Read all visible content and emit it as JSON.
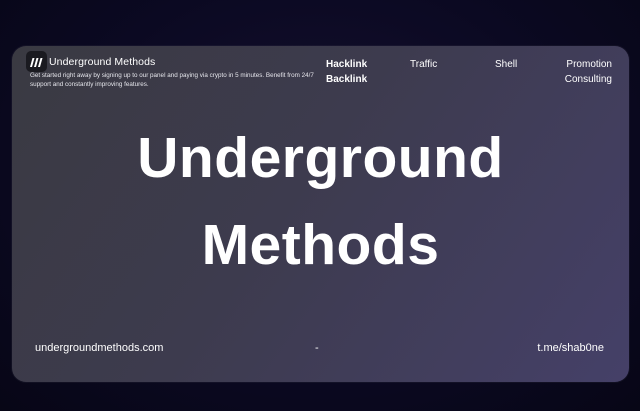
{
  "header": {
    "brand": "Underground Methods",
    "tagline": "Get started right away by signing up to our panel and paying via crypto in 5 minutes. Benefit from 24/7 support and constantly improving features."
  },
  "nav": {
    "hacklink": "Hacklink",
    "backlink": "Backlink",
    "traffic": "Traffic",
    "shell": "Shell",
    "promotion": "Promotion",
    "consulting": "Consulting"
  },
  "hero": {
    "line1": "Underground",
    "line2": "Methods"
  },
  "footer": {
    "website": "undergroundmethods.com",
    "separator": "-",
    "telegram": "t.me/shab0ne"
  },
  "icons": {
    "logo": "logo-icon"
  },
  "colors": {
    "text": "#ffffff",
    "card_start": "#3a3a42",
    "card_end": "#454068",
    "background": "#0b0922"
  }
}
